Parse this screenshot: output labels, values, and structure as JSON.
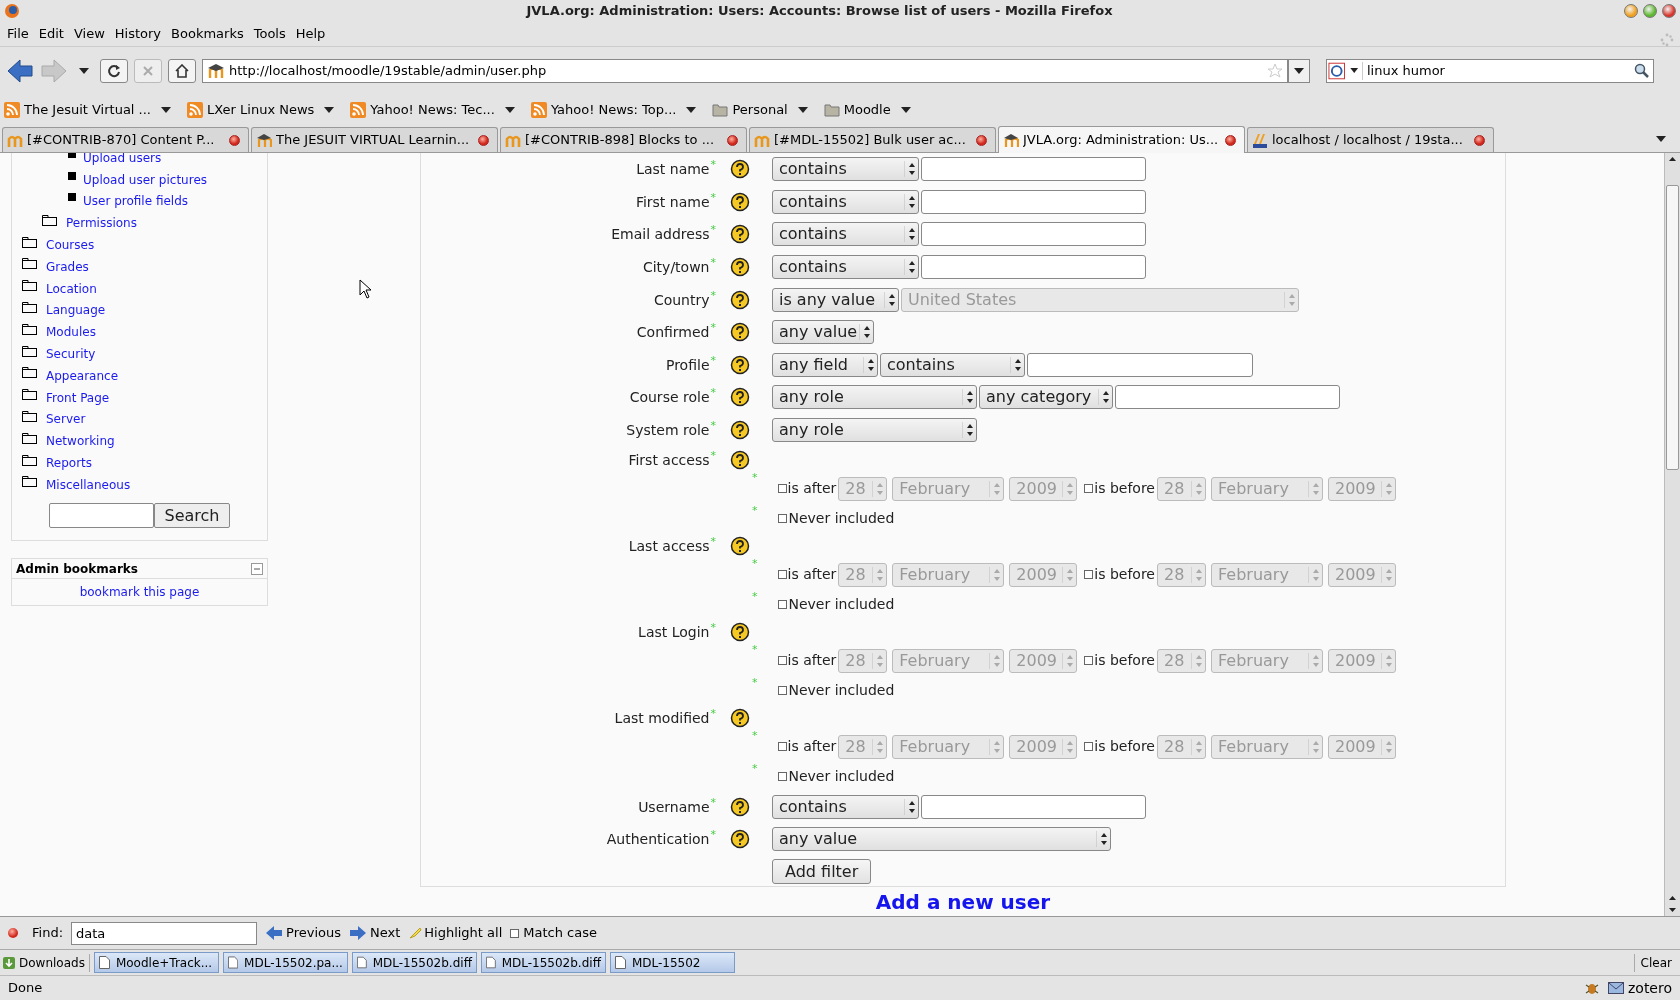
{
  "window": {
    "title": "JVLA.org: Administration: Users: Accounts: Browse list of users - Mozilla Firefox"
  },
  "menu": [
    "File",
    "Edit",
    "View",
    "History",
    "Bookmarks",
    "Tools",
    "Help"
  ],
  "url": "http://localhost/moodle/19stable/admin/user.php",
  "web_search": {
    "value": "linux humor"
  },
  "bookmarks": [
    {
      "label": "The Jesuit Virtual ...",
      "kind": "feed"
    },
    {
      "label": "LXer Linux News",
      "kind": "feed"
    },
    {
      "label": "Yahoo! News: Tec...",
      "kind": "feed"
    },
    {
      "label": "Yahoo! News: Top...",
      "kind": "feed"
    },
    {
      "label": "Personal",
      "kind": "folder"
    },
    {
      "label": "Moodle",
      "kind": "folder"
    }
  ],
  "tabs": [
    {
      "label": "[#CONTRIB-870] Content P...",
      "selected": false,
      "kind": "tracker"
    },
    {
      "label": "The JESUIT VIRTUAL Learnin...",
      "selected": false,
      "kind": "moodle"
    },
    {
      "label": "[#CONTRIB-898] Blocks to ...",
      "selected": false,
      "kind": "tracker"
    },
    {
      "label": "[#MDL-15502] Bulk user ac...",
      "selected": false,
      "kind": "tracker"
    },
    {
      "label": "JVLA.org: Administration: Us...",
      "selected": true,
      "kind": "moodle"
    },
    {
      "label": "localhost / localhost / 19sta...",
      "selected": false,
      "kind": "pma"
    }
  ],
  "sidebar": {
    "tree": [
      {
        "children": [
          {
            "children": [
              {
                "label": "Upload users"
              },
              {
                "label": "Upload user pictures"
              },
              {
                "label": "User profile fields"
              }
            ]
          },
          {
            "label": "Permissions"
          }
        ]
      },
      {
        "label": "Courses"
      },
      {
        "label": "Grades"
      },
      {
        "label": "Location"
      },
      {
        "label": "Language"
      },
      {
        "label": "Modules"
      },
      {
        "label": "Security"
      },
      {
        "label": "Appearance"
      },
      {
        "label": "Front Page"
      },
      {
        "label": "Server"
      },
      {
        "label": "Networking"
      },
      {
        "label": "Reports"
      },
      {
        "label": "Miscellaneous"
      }
    ],
    "search_button": "Search",
    "bookmarks_block": {
      "title": "Admin bookmarks",
      "link": "bookmark this page"
    }
  },
  "filters": [
    {
      "label": "Last name",
      "kind": "row",
      "controls": [
        {
          "kind": "select",
          "value": "contains"
        },
        {
          "kind": "input"
        }
      ]
    },
    {
      "label": "First name",
      "kind": "row",
      "controls": [
        {
          "kind": "select",
          "value": "contains"
        },
        {
          "kind": "input"
        }
      ]
    },
    {
      "label": "Email address",
      "kind": "row",
      "controls": [
        {
          "kind": "select",
          "value": "contains"
        },
        {
          "kind": "input"
        }
      ]
    },
    {
      "label": "City/town",
      "kind": "row",
      "controls": [
        {
          "kind": "select",
          "value": "contains"
        },
        {
          "kind": "input"
        }
      ]
    },
    {
      "label": "Country",
      "kind": "row",
      "controls": [
        {
          "kind": "select",
          "value": "is any value"
        },
        {
          "kind": "select",
          "value": "United States",
          "disabled": true
        }
      ]
    },
    {
      "label": "Confirmed",
      "kind": "row",
      "controls": [
        {
          "kind": "select",
          "value": "any value"
        }
      ]
    },
    {
      "label": "Profile",
      "kind": "row",
      "controls": [
        {
          "kind": "select",
          "value": "any field"
        },
        {
          "kind": "select",
          "value": "contains"
        },
        {
          "kind": "input"
        }
      ]
    },
    {
      "label": "Course role",
      "kind": "row",
      "controls": [
        {
          "kind": "select",
          "value": "any role"
        },
        {
          "kind": "select",
          "value": "any category"
        },
        {
          "kind": "input"
        }
      ]
    },
    {
      "label": "System role",
      "kind": "row",
      "controls": [
        {
          "kind": "select",
          "value": "any role"
        }
      ]
    },
    {
      "label": "First access",
      "kind": "date",
      "after": {
        "label": "is after",
        "checked": false,
        "day": "28",
        "month": "February",
        "year": "2009"
      },
      "before": {
        "label": "is before",
        "checked": false,
        "day": "28",
        "month": "February",
        "year": "2009"
      },
      "never": {
        "label": "Never included",
        "checked": false
      }
    },
    {
      "label": "Last access",
      "kind": "date",
      "after": {
        "label": "is after",
        "checked": false,
        "day": "28",
        "month": "February",
        "year": "2009"
      },
      "before": {
        "label": "is before",
        "checked": false,
        "day": "28",
        "month": "February",
        "year": "2009"
      },
      "never": {
        "label": "Never included",
        "checked": false
      }
    },
    {
      "label": "Last Login",
      "kind": "date",
      "after": {
        "label": "is after",
        "checked": false,
        "day": "28",
        "month": "February",
        "year": "2009"
      },
      "before": {
        "label": "is before",
        "checked": false,
        "day": "28",
        "month": "February",
        "year": "2009"
      },
      "never": {
        "label": "Never included",
        "checked": false
      }
    },
    {
      "label": "Last modified",
      "kind": "date",
      "after": {
        "label": "is after",
        "checked": false,
        "day": "28",
        "month": "February",
        "year": "2009"
      },
      "before": {
        "label": "is before",
        "checked": false,
        "day": "28",
        "month": "February",
        "year": "2009"
      },
      "never": {
        "label": "Never included",
        "checked": false
      }
    },
    {
      "label": "Username",
      "kind": "row",
      "controls": [
        {
          "kind": "select",
          "value": "contains"
        },
        {
          "kind": "input"
        }
      ]
    },
    {
      "label": "Authentication",
      "kind": "row",
      "controls": [
        {
          "kind": "select",
          "value": "any value"
        }
      ]
    }
  ],
  "required_mark": "*",
  "add_filter_button": "Add filter",
  "add_user_heading": "Add a new user",
  "find_bar": {
    "label": "Find:",
    "value": "data",
    "previous": "Previous",
    "next": "Next",
    "highlight": "Highlight all",
    "match_case": {
      "label": "Match case",
      "checked": false
    }
  },
  "downloads": {
    "label": "Downloads",
    "items": [
      "Moodle+Track...",
      "MDL-15502.pa...",
      "MDL-15502b.diff",
      "MDL-15502b.diff",
      "MDL-15502"
    ],
    "clear": "Clear"
  },
  "status_bar": {
    "text": "Done",
    "addon": "zotero"
  }
}
